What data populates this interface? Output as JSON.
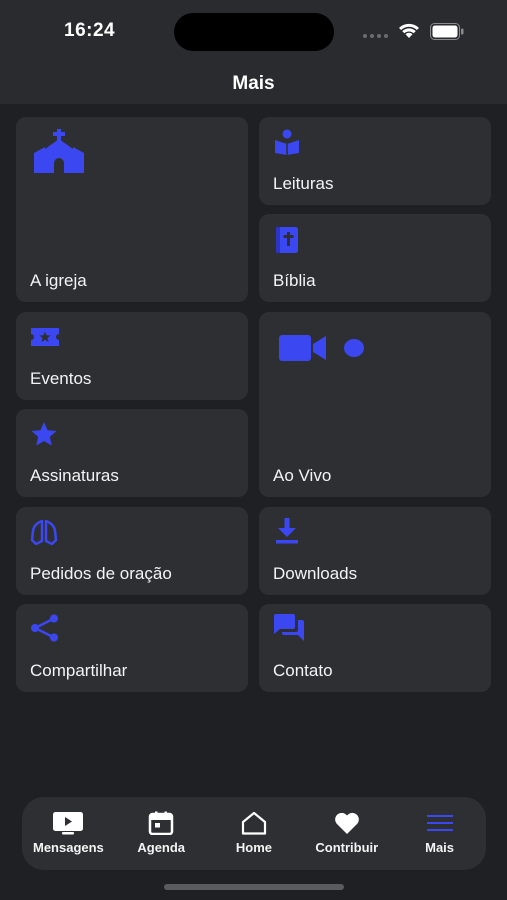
{
  "status": {
    "time": "16:24"
  },
  "header": {
    "title": "Mais"
  },
  "accent": "#3b47f1",
  "cards": {
    "igreja": {
      "label": "A igreja",
      "icon": "church-icon"
    },
    "leituras": {
      "label": "Leituras",
      "icon": "reading-icon"
    },
    "biblia": {
      "label": "Bíblia",
      "icon": "bible-icon"
    },
    "eventos": {
      "label": "Eventos",
      "icon": "ticket-icon"
    },
    "aovivo": {
      "label": "Ao Vivo",
      "icon": "video-camera-icon"
    },
    "assinaturas": {
      "label": "Assinaturas",
      "icon": "star-icon"
    },
    "pedidos": {
      "label": "Pedidos de oração",
      "icon": "praying-hands-icon"
    },
    "downloads": {
      "label": "Downloads",
      "icon": "download-icon"
    },
    "compartilhar": {
      "label": "Compartilhar",
      "icon": "share-icon"
    },
    "contato": {
      "label": "Contato",
      "icon": "chat-icon"
    }
  },
  "tabs": [
    {
      "label": "Mensagens",
      "icon": "tv-icon"
    },
    {
      "label": "Agenda",
      "icon": "calendar-icon"
    },
    {
      "label": "Home",
      "icon": "home-icon"
    },
    {
      "label": "Contribuir",
      "icon": "heart-icon"
    },
    {
      "label": "Mais",
      "icon": "menu-icon",
      "active": true
    }
  ]
}
